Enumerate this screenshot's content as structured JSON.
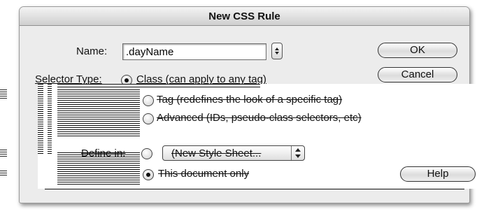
{
  "dialog": {
    "title": "New CSS Rule",
    "name_label": "Name:",
    "name_value": ".dayName",
    "selector_type_label": "Selector Type:",
    "selector_options": [
      {
        "label": "Class (can apply to any tag)",
        "selected": true
      },
      {
        "label": "Tag (redefines the look of a specific tag)",
        "selected": false
      },
      {
        "label": "Advanced (IDs, pseudo-class selectors, etc)",
        "selected": false
      }
    ],
    "define_in_label": "Define in:",
    "define_in_options": [
      {
        "label": "(New Style Sheet...",
        "selected": false
      },
      {
        "label": "This document only",
        "selected": true
      }
    ],
    "buttons": {
      "ok": "OK",
      "cancel": "Cancel",
      "help": "Help"
    }
  }
}
